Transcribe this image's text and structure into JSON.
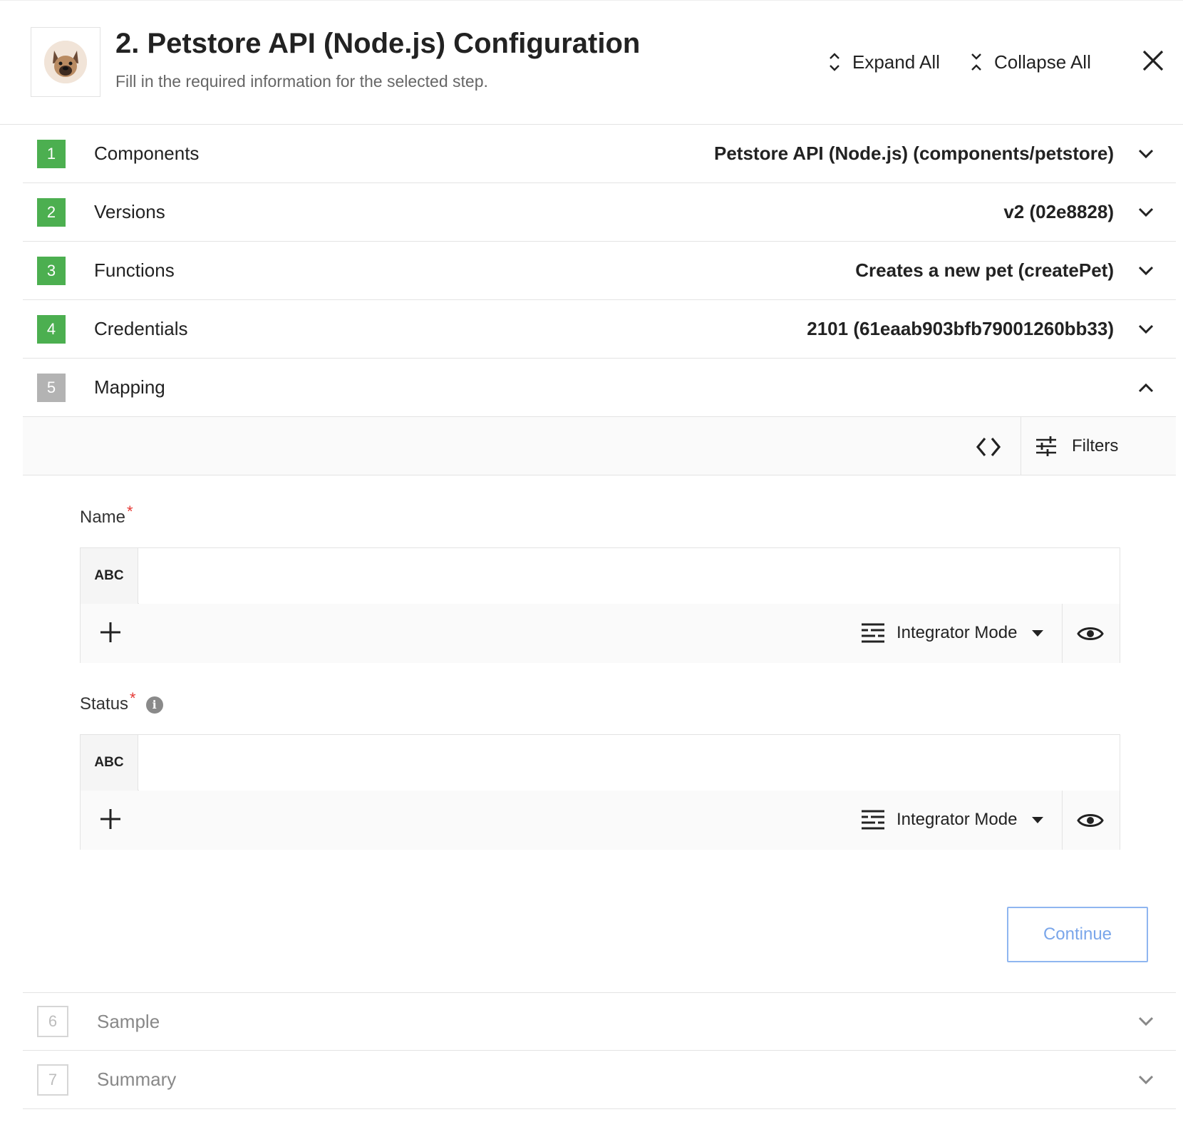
{
  "header": {
    "title": "2. Petstore API (Node.js) Configuration",
    "subtitle": "Fill in the required information for the selected step.",
    "expand_all": "Expand All",
    "collapse_all": "Collapse All"
  },
  "steps": [
    {
      "number": "1",
      "label": "Components",
      "value": "Petstore API (Node.js) (components/petstore)",
      "state": "done"
    },
    {
      "number": "2",
      "label": "Versions",
      "value": "v2 (02e8828)",
      "state": "done"
    },
    {
      "number": "3",
      "label": "Functions",
      "value": "Creates a new pet (createPet)",
      "state": "done"
    },
    {
      "number": "4",
      "label": "Credentials",
      "value": "2101 (61eaab903bfb79001260bb33)",
      "state": "done"
    },
    {
      "number": "5",
      "label": "Mapping",
      "value": "",
      "state": "active"
    },
    {
      "number": "6",
      "label": "Sample",
      "value": "",
      "state": "todo"
    },
    {
      "number": "7",
      "label": "Summary",
      "value": "",
      "state": "todo"
    }
  ],
  "mapping": {
    "filters_label": "Filters",
    "fields": [
      {
        "label": "Name",
        "required_mark": "*",
        "type_tag": "ABC",
        "value": "",
        "mode": "Integrator Mode"
      },
      {
        "label": "Status",
        "required_mark": "*",
        "info": "i",
        "type_tag": "ABC",
        "value": "",
        "mode": "Integrator Mode"
      }
    ],
    "continue_label": "Continue"
  },
  "colors": {
    "done_badge": "#4caf50",
    "active_badge": "#b3b3b3",
    "required": "#e53935",
    "continue_border": "#8fb6f0"
  },
  "icons": [
    "expand-icon",
    "collapse-icon",
    "close-icon",
    "chevron-down-icon",
    "chevron-up-icon",
    "code-icon",
    "filters-icon",
    "plus-icon",
    "lines-icon",
    "caret-down-icon",
    "eye-icon",
    "info-icon"
  ]
}
